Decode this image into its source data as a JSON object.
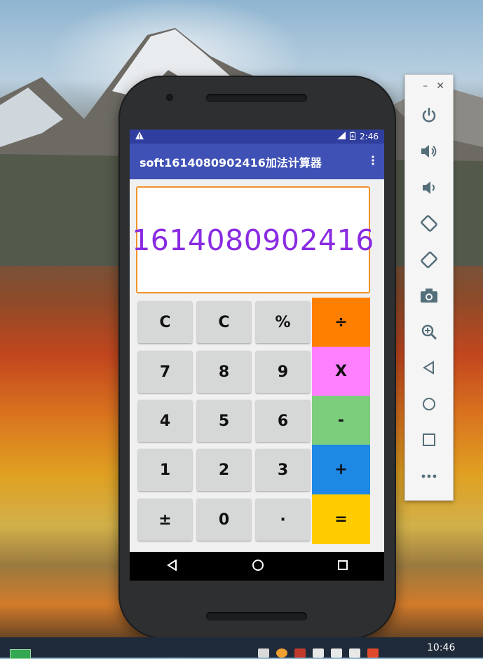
{
  "device": {
    "status_bar": {
      "warning_icon": "warning-icon",
      "time": "2:46"
    },
    "app_bar": {
      "title": "soft1614080902416加法计算器",
      "menu_icon": "more-vert-icon"
    },
    "display": {
      "value": "1614080902416"
    },
    "keypad": {
      "rows": [
        [
          "C",
          "C",
          "%"
        ],
        [
          "7",
          "8",
          "9"
        ],
        [
          "4",
          "5",
          "6"
        ],
        [
          "1",
          "2",
          "3"
        ],
        [
          "±",
          "0",
          "·"
        ]
      ],
      "operators": [
        {
          "label": "÷",
          "color": "#ff7f00"
        },
        {
          "label": "X",
          "color": "#ff80ff"
        },
        {
          "label": "-",
          "color": "#7ccd7c"
        },
        {
          "label": "+",
          "color": "#1e88e5"
        },
        {
          "label": "=",
          "color": "#ffcc00"
        }
      ]
    },
    "nav_bar": [
      "back-icon",
      "home-icon",
      "recents-icon"
    ]
  },
  "emulator_toolbar": {
    "window_controls": [
      "minimize-icon",
      "close-icon"
    ],
    "buttons": [
      "power-icon",
      "volume-up-icon",
      "volume-down-icon",
      "rotate-left-icon",
      "rotate-right-icon",
      "camera-icon",
      "zoom-icon",
      "back-icon",
      "home-icon",
      "overview-icon",
      "more-icon"
    ]
  },
  "taskbar": {
    "time": "10:46"
  },
  "colors": {
    "status_bar": "#303f9f",
    "app_bar": "#3f51b5",
    "display_text": "#8a2be2",
    "display_border": "#f0932b"
  }
}
